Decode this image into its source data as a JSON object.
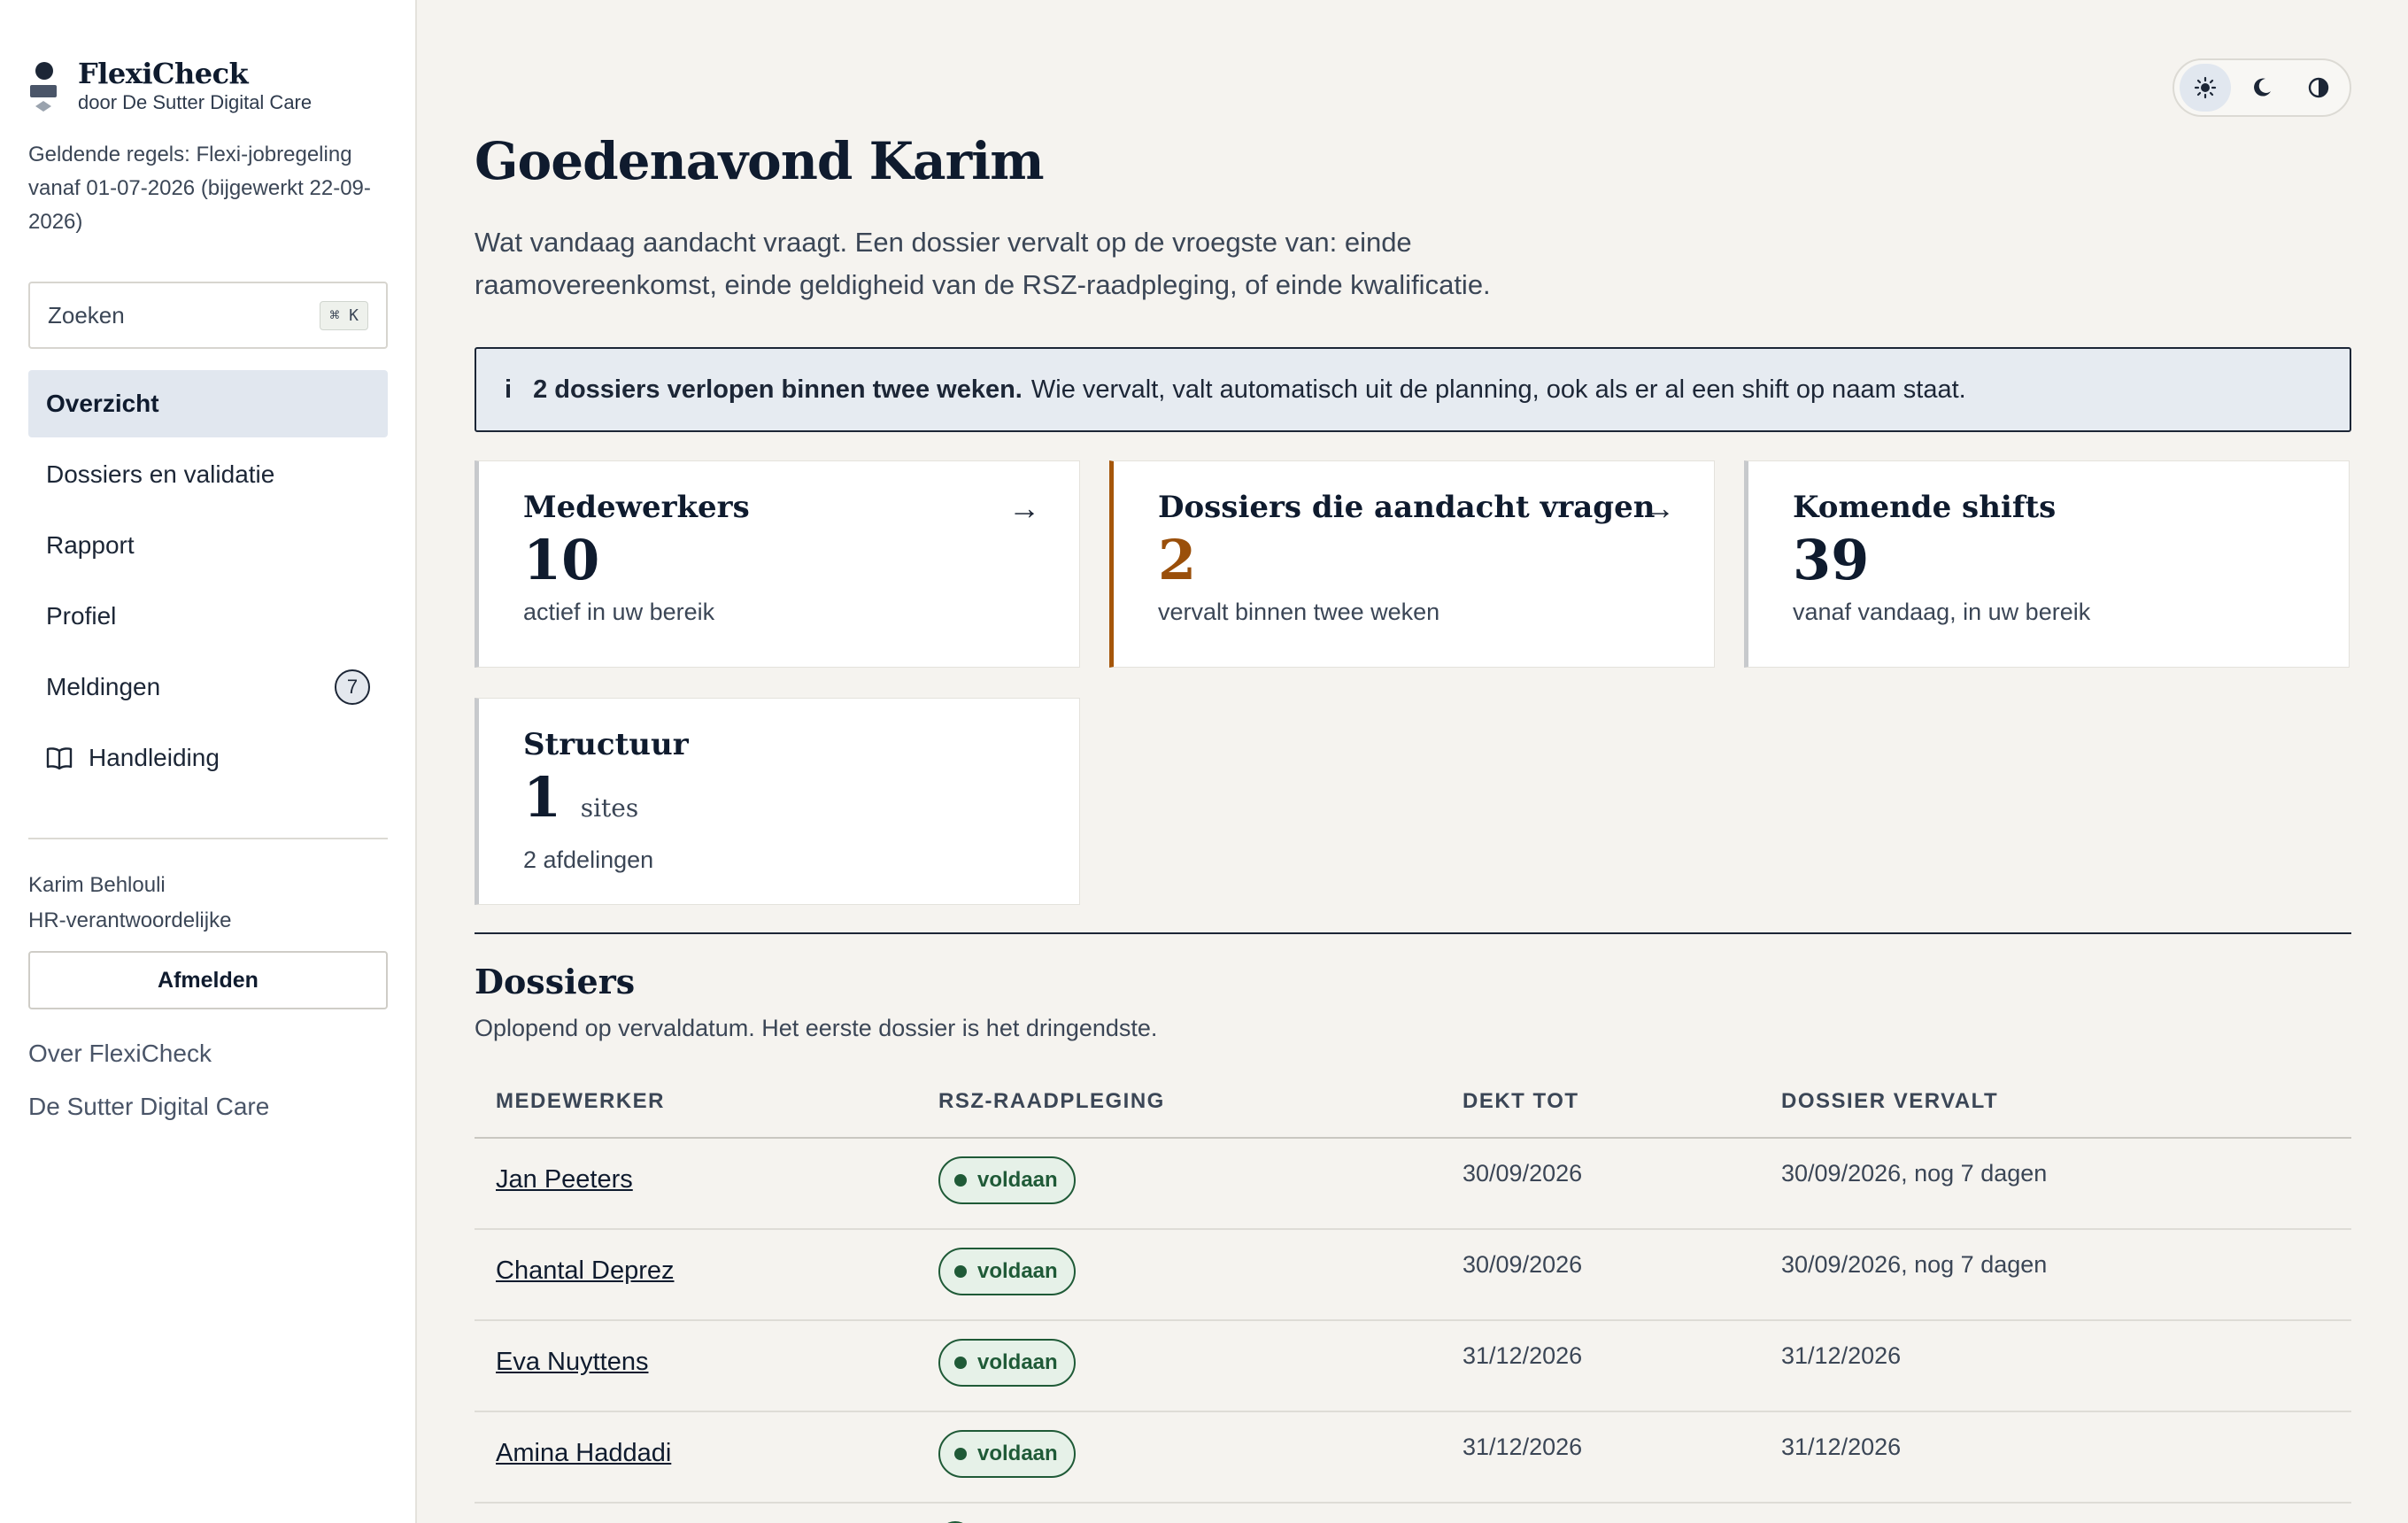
{
  "brand": {
    "title": "FlexiCheck",
    "subtitle": "door De Sutter Digital Care"
  },
  "rules_text": "Geldende regels: Flexi-jobregeling vanaf 01-07-2026 (bijgewerkt 22-09-2026)",
  "search": {
    "label": "Zoeken",
    "shortcut": "⌘ K"
  },
  "nav": {
    "items": [
      {
        "label": "Overzicht",
        "active": true
      },
      {
        "label": "Dossiers en validatie"
      },
      {
        "label": "Rapport"
      },
      {
        "label": "Profiel"
      },
      {
        "label": "Meldingen",
        "badge": "7"
      },
      {
        "label": "Handleiding",
        "icon": "book-icon"
      }
    ]
  },
  "user": {
    "name": "Karim Behlouli",
    "role": "HR-verantwoordelijke",
    "logout_label": "Afmelden"
  },
  "footer_links": [
    "Over FlexiCheck",
    "De Sutter Digital Care"
  ],
  "theme": {
    "options": [
      "sun-icon",
      "moon-icon",
      "contrast-icon"
    ],
    "selected": "sun-icon"
  },
  "main": {
    "title": "Goedenavond Karim",
    "intro": "Wat vandaag aandacht vraagt. Een dossier vervalt op de vroegste van: einde raamovereenkomst, einde geldigheid van de RSZ-raadpleging, of einde kwalificatie.",
    "alert": {
      "icon_label": "i",
      "bold": "2 dossiers verlopen binnen twee weken.",
      "text": "Wie vervalt, valt automatisch uit de planning, ook als er al een shift op naam staat."
    },
    "cards": [
      {
        "title": "Medewerkers",
        "value": "10",
        "sub": "actief in uw bereik",
        "arrow": "→"
      },
      {
        "title": "Dossiers die aandacht vragen",
        "value": "2",
        "sub": "vervalt binnen twee weken",
        "arrow": "→",
        "accent": "#a5560a"
      },
      {
        "title": "Komende shifts",
        "value": "39",
        "sub": "vanaf vandaag, in uw bereik"
      },
      {
        "title": "Structuur",
        "value": "1",
        "unit": "sites",
        "sub": "2 afdelingen"
      }
    ]
  },
  "dossiers": {
    "title": "Dossiers",
    "subtitle": "Oplopend op vervaldatum. Het eerste dossier is het dringendste.",
    "columns": [
      "MEDEWERKER",
      "RSZ-RAADPLEGING",
      "DEKT TOT",
      "DOSSIER VERVALT"
    ],
    "rows": [
      {
        "name": "Jan Peeters",
        "status": "voldaan",
        "covers": "30/09/2026",
        "expires": "30/09/2026, nog 7 dagen"
      },
      {
        "name": "Chantal Deprez",
        "status": "voldaan",
        "covers": "30/09/2026",
        "expires": "30/09/2026, nog 7 dagen"
      },
      {
        "name": "Eva Nuyttens",
        "status": "voldaan",
        "covers": "31/12/2026",
        "expires": "31/12/2026"
      },
      {
        "name": "Amina Haddadi",
        "status": "voldaan",
        "covers": "31/12/2026",
        "expires": "31/12/2026"
      }
    ]
  },
  "colors": {
    "accent_warning": "#a5560a",
    "status_ok": "#1f5a37",
    "navy": "#0f1b2e"
  }
}
